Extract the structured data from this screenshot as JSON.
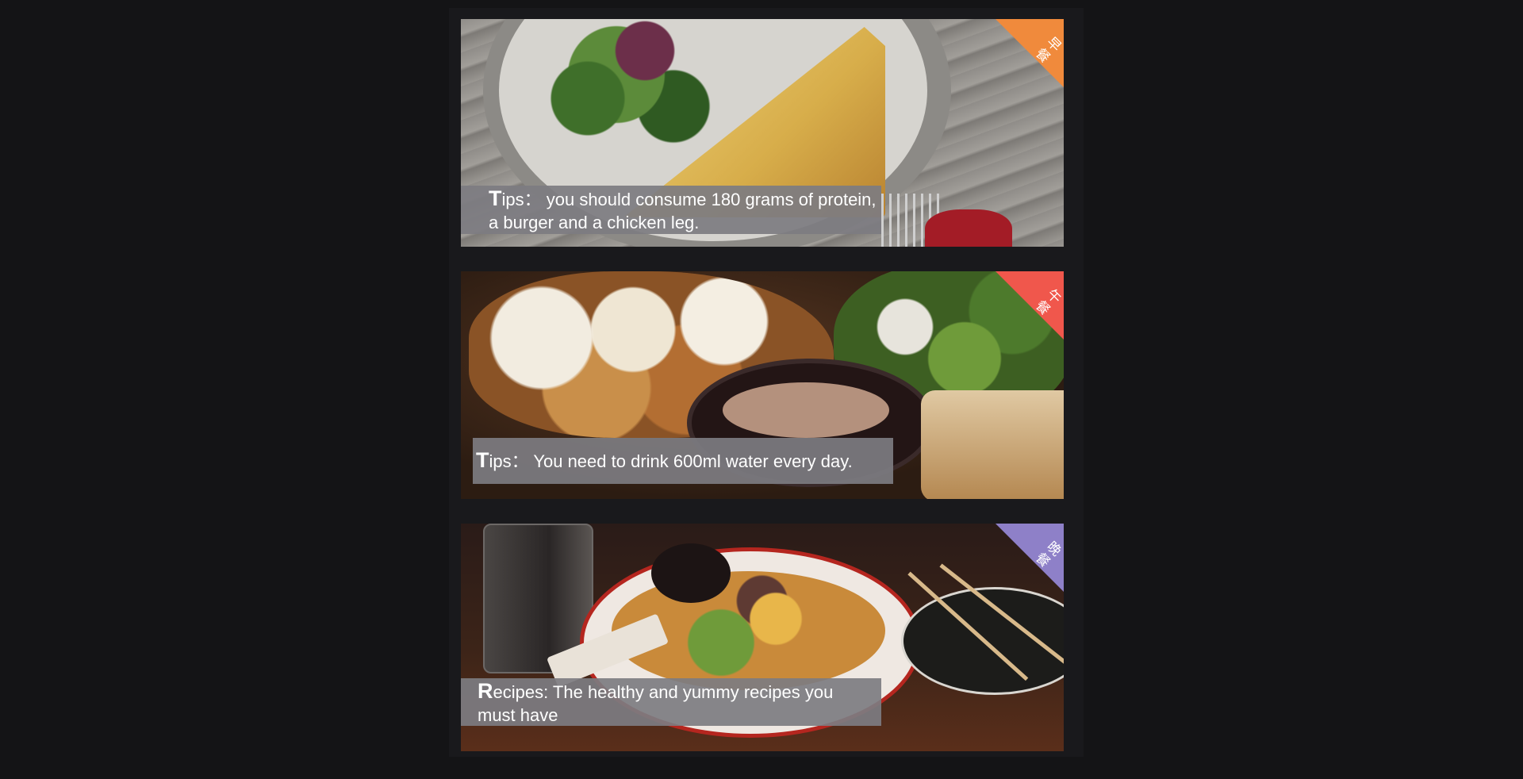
{
  "cards": [
    {
      "tag": "早餐",
      "tag_color": "#f08a3c",
      "lead": "T",
      "text": "ips：  you should consume 180 grams of protein, a burger and a chicken leg.",
      "photo": "quiche-salad-photo"
    },
    {
      "tag": "午餐",
      "tag_color": "#f0574c",
      "lead": "T",
      "text": "ips：  You need to drink 600ml water every day.",
      "photo": "lobster-salad-photo"
    },
    {
      "tag": "晚餐",
      "tag_color": "#8e80c8",
      "lead": "R",
      "text": "ecipes: The healthy and yummy recipes you must have",
      "photo": "ramen-photo"
    }
  ]
}
